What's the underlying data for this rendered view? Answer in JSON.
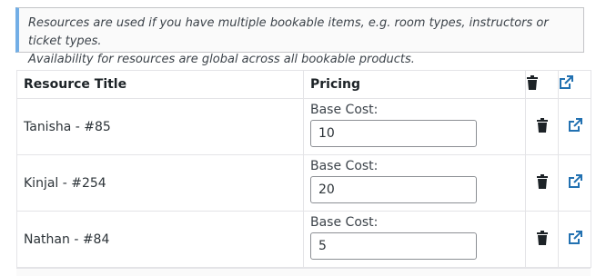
{
  "notice": {
    "line1": "Resources are used if you have multiple bookable items, e.g. room types, instructors or ticket types.",
    "line2": "Availability for resources are global across all bookable products."
  },
  "table": {
    "headers": {
      "title": "Resource Title",
      "pricing": "Pricing"
    },
    "rows": [
      {
        "title": "Tanisha - #85",
        "pricing_label": "Base Cost:",
        "base_cost": "10"
      },
      {
        "title": "Kinjal - #254",
        "pricing_label": "Base Cost:",
        "base_cost": "20"
      },
      {
        "title": "Nathan - #84",
        "pricing_label": "Base Cost:",
        "base_cost": "5"
      }
    ]
  },
  "icons": {
    "delete": "trash-icon",
    "open": "external-link-icon"
  },
  "colors": {
    "accent": "#2271b1",
    "notice_border": "#72aee6",
    "icon_dark": "#1d2327"
  }
}
